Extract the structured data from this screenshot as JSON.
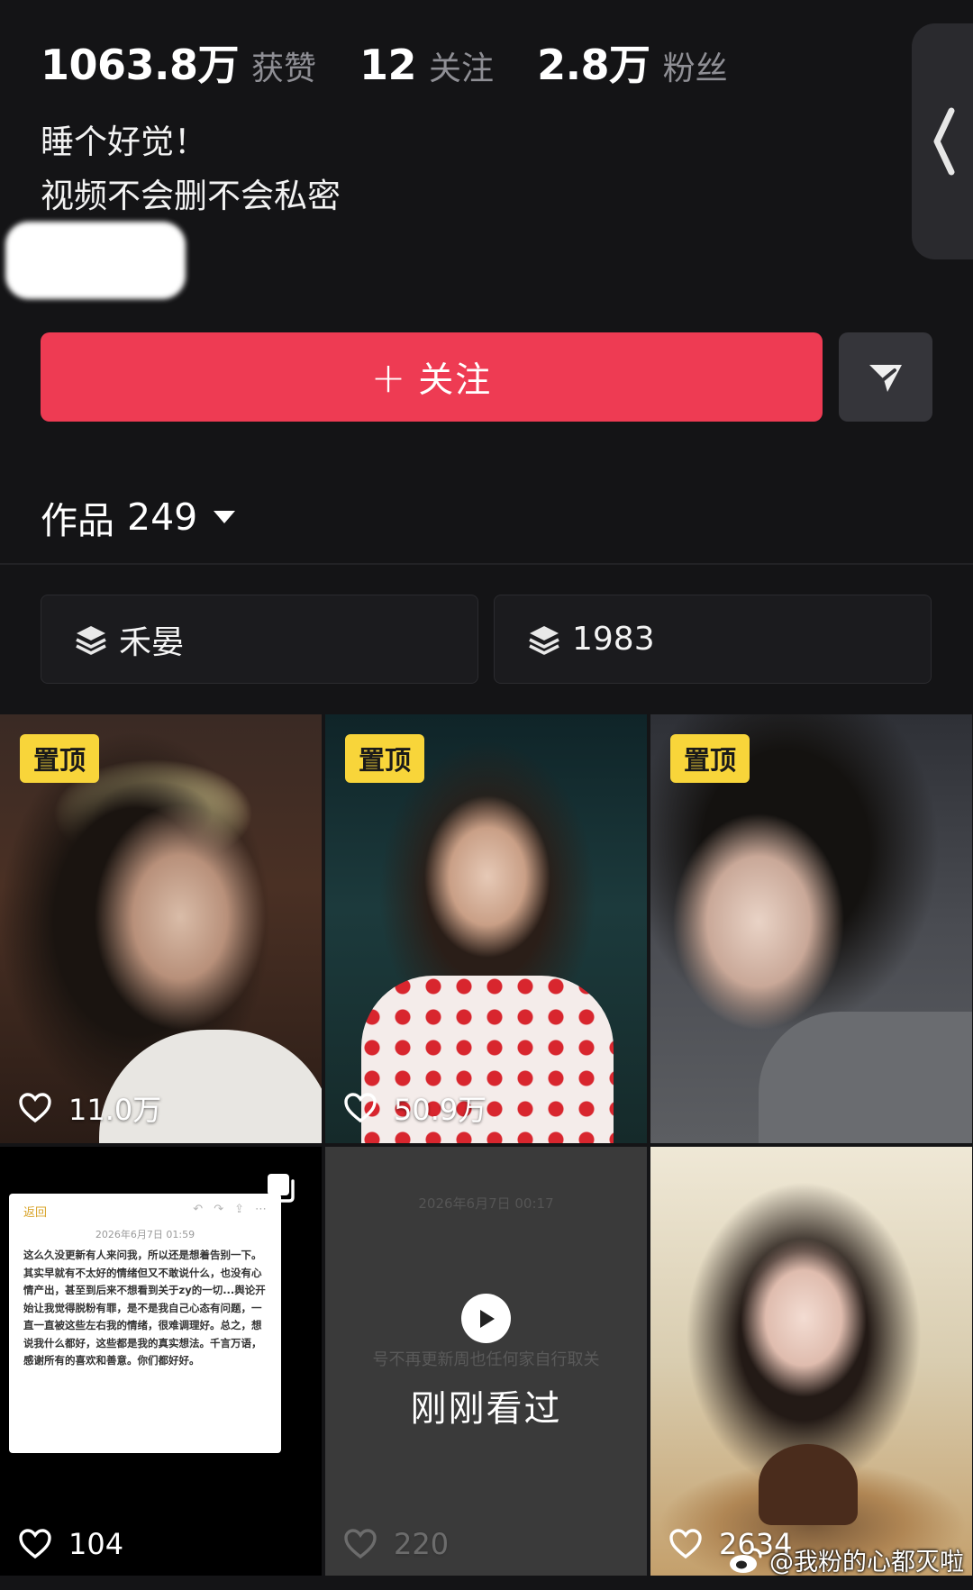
{
  "stats": [
    {
      "value": "1063.8万",
      "label": "获赞"
    },
    {
      "value": "12",
      "label": "关注"
    },
    {
      "value": "2.8万",
      "label": "粉丝"
    }
  ],
  "bio": {
    "line1": "睡个好觉！",
    "line2": "视频不会删不会私密"
  },
  "actions": {
    "follow_plus": "+",
    "follow_label": "关注"
  },
  "works": {
    "label": "作品",
    "count": "249"
  },
  "collections": [
    {
      "label": "禾晏"
    },
    {
      "label": "1983"
    }
  ],
  "videos": [
    {
      "pinned": "置顶",
      "likes": "11.0万"
    },
    {
      "pinned": "置顶",
      "likes": "50.9万"
    },
    {
      "pinned": "置顶",
      "likes": ""
    },
    {
      "likes": "104"
    },
    {
      "likes": "220",
      "overlay": "刚刚看过"
    },
    {
      "likes": "2634"
    }
  ],
  "note_card": {
    "back": "返回",
    "date": "2026年6月7日 01:59",
    "text": "这么久没更新有人来问我，所以还是想着告别一下。其实早就有不太好的情绪但又不敢说什么，也没有心情产出，甚至到后来不想看到关于zy的一切...舆论开始让我觉得脱粉有罪，是不是我自己心态有问题，一直一直被这些左右我的情绪，很难调理好。总之，想说我什么都好，这些都是我的真实想法。千言万语，感谢所有的喜欢和善意。你们都好好。"
  },
  "just_watched": {
    "ghost_date": "2026年6月7日 00:17",
    "ghost_text": "号不再更新周也任何家自行取关"
  },
  "watermark": "@我粉的心都灭啦",
  "colors": {
    "background": "#141416",
    "follow_button": "#ee3b53",
    "pin_badge": "#f8d53a",
    "secondary_text": "#8f8f95"
  }
}
